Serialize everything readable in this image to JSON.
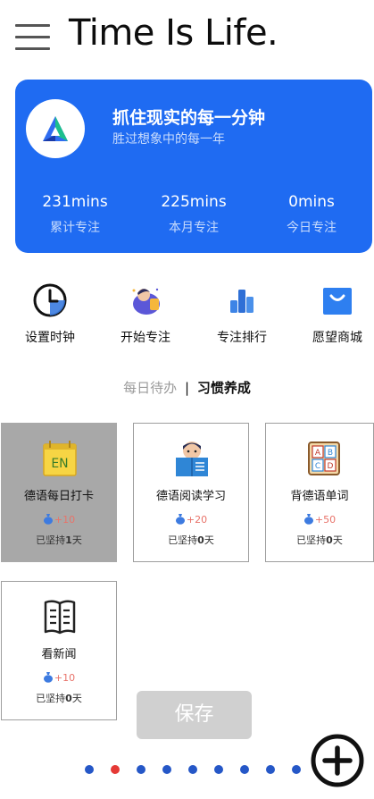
{
  "header": {
    "title": "Time Is Life."
  },
  "card": {
    "slogan": "抓住现实的每一分钟",
    "subslogan": "胜过想象中的每一年",
    "stats": [
      {
        "value": "231mins",
        "label": "累计专注"
      },
      {
        "value": "225mins",
        "label": "本月专注"
      },
      {
        "value": "0mins",
        "label": "今日专注"
      }
    ]
  },
  "quick_actions": [
    {
      "label": "设置时钟",
      "icon": "clock-icon"
    },
    {
      "label": "开始专注",
      "icon": "focus-person-icon"
    },
    {
      "label": "专注排行",
      "icon": "ranking-bar-icon"
    },
    {
      "label": "愿望商城",
      "icon": "shopping-bag-icon"
    }
  ],
  "tabs": {
    "daily": "每日待办",
    "separator": "|",
    "habits": "习惯养成",
    "active": "habits"
  },
  "habits": [
    {
      "name": "德语每日打卡",
      "reward": "+10",
      "streak_prefix": "已坚持",
      "streak_days": "1",
      "streak_suffix": "天",
      "icon": "en-calendar-icon",
      "selected": true
    },
    {
      "name": "德语阅读学习",
      "reward": "+20",
      "streak_prefix": "已坚持",
      "streak_days": "0",
      "streak_suffix": "天",
      "icon": "reading-boy-icon",
      "selected": false
    },
    {
      "name": "背德语单词",
      "reward": "+50",
      "streak_prefix": "已坚持",
      "streak_days": "0",
      "streak_suffix": "天",
      "icon": "abcd-blocks-icon",
      "selected": false
    },
    {
      "name": "看新闻",
      "reward": "+10",
      "streak_prefix": "已坚持",
      "streak_days": "0",
      "streak_suffix": "天",
      "icon": "newspaper-icon",
      "selected": false
    }
  ],
  "save_label": "保存",
  "pager": {
    "count": 9,
    "active_index": 1
  },
  "colors": {
    "primary": "#1f6bf2",
    "reward": "#e8736a",
    "dot": "#2557c7",
    "dot_active": "#e53935"
  }
}
